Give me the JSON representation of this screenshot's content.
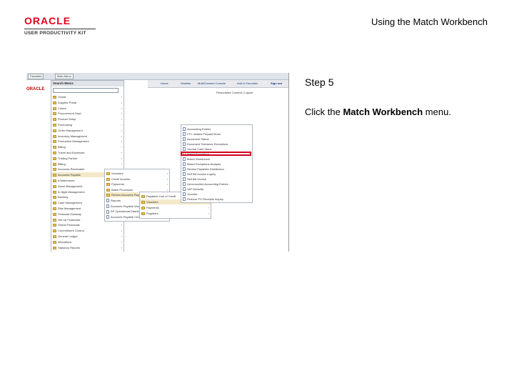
{
  "header": {
    "logo_oracle": "ORACLE",
    "logo_sub": "USER PRODUCTIVITY KIT",
    "doc_title": "Using the Match Workbench"
  },
  "step": {
    "label": "Step 5",
    "instruction_prefix": "Click the ",
    "instruction_bold": "Match Workbench",
    "instruction_suffix": " menu."
  },
  "screenshot": {
    "topbar": {
      "favorites": "Favorites",
      "main_menu": "Main Menu"
    },
    "nav_links": [
      "Home",
      "Worklist",
      "MultiChannel Console",
      "Add to Favorites",
      "Sign out"
    ],
    "personalize": "Personalize Content | Layout",
    "search_menu_title": "Search Menu:",
    "main_menu_items": [
      "Oracle",
      "Supplier Portal",
      "Cubes",
      "Procurement Dept.",
      "Product Setup",
      "Purchasing",
      "Order Management",
      "Inventory Management",
      "Production Management",
      "Billing",
      "Travel and Expenses",
      "Trading Partner",
      "Billing",
      "Accounts Receivable",
      "Accounts Payable",
      "eSettlements",
      "Asset Management",
      "In-flight Management",
      "Banking",
      "Cash Management",
      "Risk Management",
      "Financial Gateway",
      "Set Up Financials",
      "Global Financials",
      "Commitment Control",
      "General Ledger",
      "Allocations",
      "Statutory Reports"
    ],
    "ap_submenu": [
      "Vouchers",
      "Credit Voucher",
      "Payments",
      "Batch Processes",
      "Review Accounts Payable",
      "Reports",
      "Accounts Payable Workbench",
      "AP Operational Dashboard",
      "Accounts Payable Center"
    ],
    "review_submenu": [
      "Payables Line of Credit",
      "Vouchers",
      "Payments",
      "Suppliers"
    ],
    "voucher_submenu": [
      "Accounting Entries",
      "FTC related Prepaid Items",
      "Document Status",
      "Document Tolerance Exceptions",
      "Journal Cash Items",
      "Match Exceptions",
      "Match Workbench",
      "Match Exceptions Analysis",
      "Review Payables Distribution",
      "Self Bill Invoice Inquiry",
      "Self Bill Invoice",
      "Unreconciled Accounting Entries",
      "VAT Defaults",
      "Voucher",
      "Perform PO Receipts Inquiry"
    ]
  }
}
